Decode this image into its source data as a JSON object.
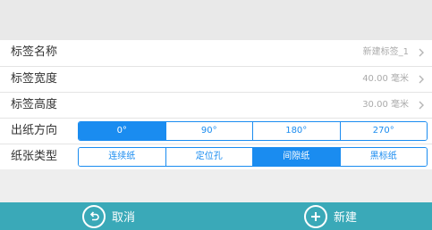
{
  "form": {
    "label_name": {
      "label": "标签名称",
      "value": "新建标签_1"
    },
    "label_width": {
      "label": "标签宽度",
      "value": "40.00 毫米"
    },
    "label_height": {
      "label": "标签高度",
      "value": "30.00 毫米"
    },
    "print_direction": {
      "label": "出纸方向",
      "options": [
        "0°",
        "90°",
        "180°",
        "270°"
      ],
      "selected": "0°"
    },
    "paper_type": {
      "label": "纸张类型",
      "options": [
        "连续纸",
        "定位孔",
        "间隙纸",
        "黑标纸"
      ],
      "selected": "间隙纸"
    }
  },
  "footer": {
    "cancel": {
      "label": "取消",
      "icon": "undo-circle-icon"
    },
    "create": {
      "label": "新建",
      "icon": "plus-circle-icon"
    }
  },
  "colors": {
    "accent": "#1a8cf0",
    "footer": "#3aa9b8"
  }
}
